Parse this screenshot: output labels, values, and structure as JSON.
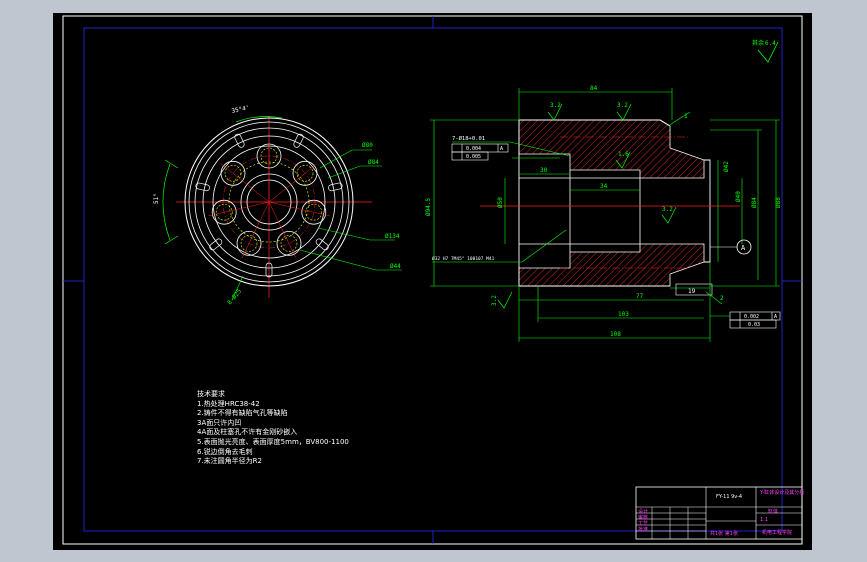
{
  "colors": {
    "background": "#000000",
    "outline": "#ffffff",
    "dimension": "#00ff00",
    "centerline": "#ff0000",
    "hidden": "#ffff00",
    "frame": "#0000ff",
    "titleblock_text": "#ff40ff"
  },
  "roughness": {
    "corner": "其余",
    "corner_value": "6.4",
    "r1": "3.2",
    "r2": "3.2",
    "r3": "1.6",
    "r4": "3.2",
    "r5": "3.2"
  },
  "left_view": {
    "dims": {
      "angle1": "35°4'",
      "angle2": "51°",
      "d_a": "Ø80",
      "d_b": "Ø84",
      "d_c": "Ø134",
      "d_d": "Ø44",
      "d_e": "8-Ø25"
    }
  },
  "right_view": {
    "dims": {
      "top": "84",
      "len30": "30",
      "len34": "34",
      "len77": "77",
      "len19": "19",
      "len103": "103",
      "len108": "108",
      "d_left_big": "Ø94.5",
      "d_bore": "Ø50",
      "d_right1": "Ø42",
      "d_right2": "Ø40",
      "d_right3": "Ø84",
      "d_right4": "Ø88",
      "ch1": "1",
      "ch2": "2",
      "hole_note": "7-Ø18+0.01",
      "tol1_val": "0.004",
      "tol1_ref": "A",
      "tol2_val": "0.005",
      "tol3_val": "0.002",
      "tol3_ref": "A",
      "tol4_val": "0.03",
      "datum": "A",
      "thread_note": "Ø32 H7 7M45° 100107 M41"
    }
  },
  "notes": {
    "title": "技术要求",
    "lines": [
      "1.热处理HRC38-42",
      "2.铸件不得有缺陷气孔等缺陷",
      "3A面只许内凹",
      "4A面及柱塞孔不许有金刚砂嵌入",
      "5.表面抛光亮度、表面厚度5mm，BV800-1100",
      "6.锐边倒角去毛刺",
      "7.未注圆角半径为R2"
    ]
  },
  "title_block": {
    "drawing_no": "FY-11 9v-4",
    "school": "Y-缸体设计及其分析",
    "material": "缸体",
    "scale": "1:1",
    "org": "机电工程学院",
    "rows": [
      "设计",
      "审核",
      "工艺",
      "批准"
    ],
    "sheet": "共1张 第1张"
  }
}
